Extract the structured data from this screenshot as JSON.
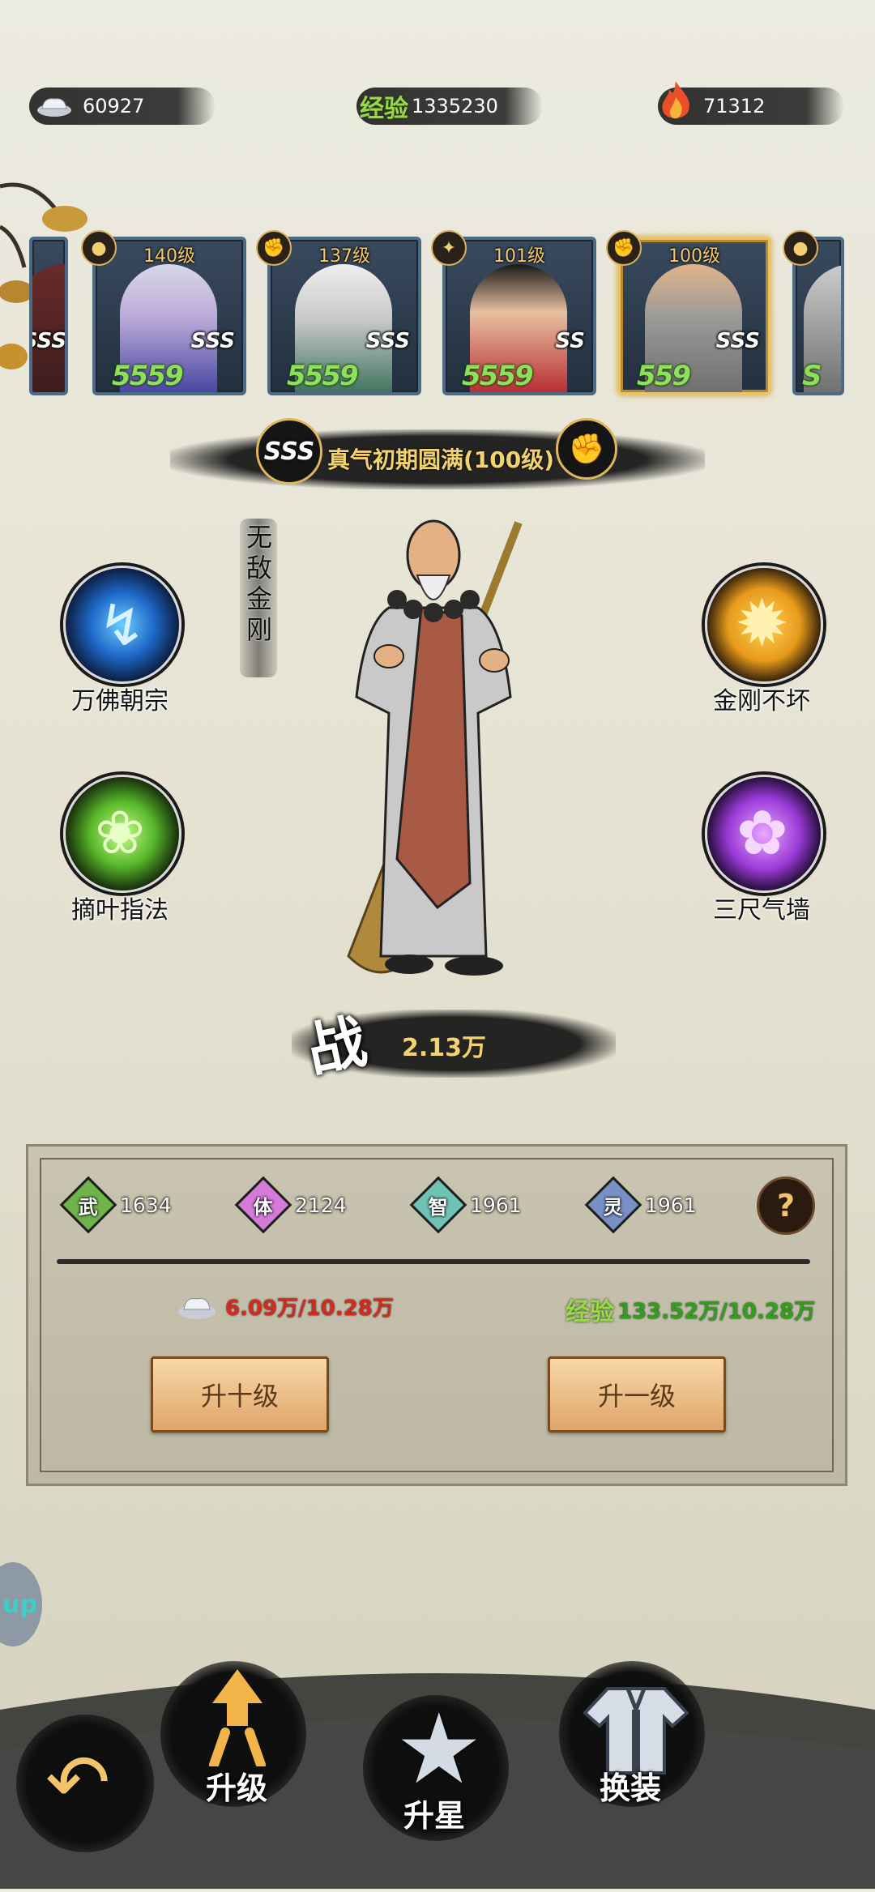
{
  "resources": {
    "silver": "60927",
    "exp_label": "经验",
    "exp_value": "1335230",
    "fire": "71312"
  },
  "heroes": [
    {
      "level": "",
      "rank": "SSS",
      "stars": ""
    },
    {
      "level": "140级",
      "rank": "SSS",
      "stars": "5559"
    },
    {
      "level": "137级",
      "rank": "SSS",
      "stars": "5559"
    },
    {
      "level": "101级",
      "rank": "SS",
      "stars": "5559"
    },
    {
      "level": "100级",
      "rank": "SSS",
      "stars": "559"
    },
    {
      "level": "",
      "rank": "",
      "stars": "S"
    }
  ],
  "hero": {
    "rank": "SSS",
    "realm": "真气初期圆满(100级)",
    "name_vertical": "无敌金刚",
    "battle_char": "战",
    "power": "2.13万"
  },
  "skills": [
    {
      "name": "万佛朝宗",
      "icon": "lightning-icon"
    },
    {
      "name": "金刚不坏",
      "icon": "golden-burst-icon"
    },
    {
      "name": "摘叶指法",
      "icon": "leaf-icon"
    },
    {
      "name": "三尺气墙",
      "icon": "purple-qi-icon"
    }
  ],
  "stats": [
    {
      "char": "武",
      "value": "1634",
      "color": "#6fb34a"
    },
    {
      "char": "体",
      "value": "2124",
      "color": "#d47ad8"
    },
    {
      "char": "智",
      "value": "1961",
      "color": "#6fc3b4"
    },
    {
      "char": "灵",
      "value": "1961",
      "color": "#7890c8"
    }
  ],
  "help_label": "?",
  "cost": {
    "silver": "6.09万/10.28万",
    "exp_label": "经验",
    "exp": "133.52万/10.28万"
  },
  "buttons": {
    "up_ten": "升十级",
    "up_one": "升一级"
  },
  "side_tab": "up",
  "nav": {
    "upgrade": "升级",
    "star": "升星",
    "equip": "换装"
  },
  "colors": {
    "cost_red": "#d42a1e",
    "exp_green": "#2ea11a",
    "exp_label_green": "#9ad84a"
  }
}
